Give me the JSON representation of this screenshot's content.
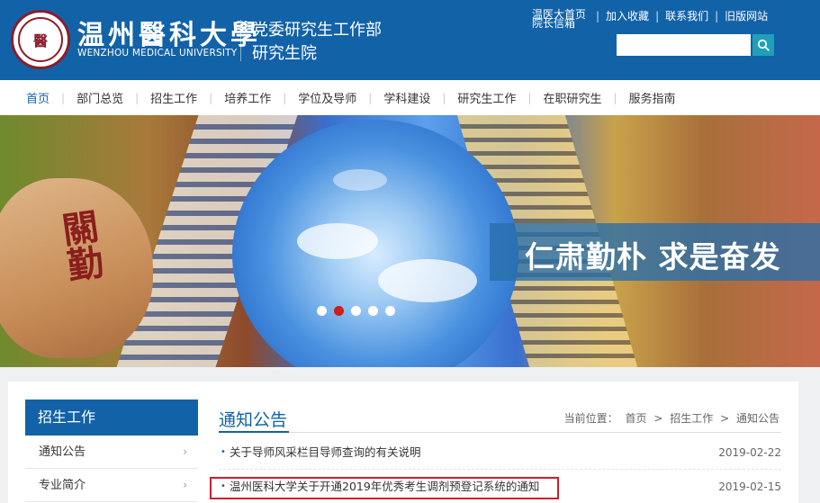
{
  "header": {
    "logo_cn": "温州醫科大學",
    "logo_en": "WENZHOU MEDICAL UNIVERSITY",
    "seal_char": "醫",
    "dept_line1": "党委研究生工作部",
    "dept_line2": "研究生院",
    "toplinks": {
      "stack_a": "温医大首页",
      "stack_b": "院长信箱",
      "favorite": "加入收藏",
      "contact": "联系我们",
      "old_site": "旧版网站",
      "sep": "|"
    },
    "search": {
      "placeholder": ""
    }
  },
  "nav": [
    "首页",
    "部门总览",
    "招生工作",
    "培养工作",
    "学位及导师",
    "学科建设",
    "研究生工作",
    "在职研究生",
    "服务指南"
  ],
  "nav_sep": "|",
  "banner": {
    "rock_text": "關勤",
    "slogan": "仁肃勤朴 求是奋发",
    "slide_count": 5,
    "active_slide": 2
  },
  "sidebar": {
    "title": "招生工作",
    "items": [
      {
        "label": "通知公告"
      },
      {
        "label": "专业简介"
      }
    ],
    "chevron": "›"
  },
  "main": {
    "title": "通知公告",
    "breadcrumb": {
      "prefix": "当前位置：",
      "home": "首页",
      "level1": "招生工作",
      "level2": "通知公告",
      "sep": ">"
    },
    "news": [
      {
        "title": "关于导师风采栏目导师查询的有关说明",
        "date": "2019-02-22"
      },
      {
        "title": "温州医科大学关于开通2019年优秀考生调剂预登记系统的通知",
        "date": "2019-02-15"
      }
    ],
    "bullet": "•"
  },
  "colors": {
    "brand": "#1262a8",
    "accent": "#1fa0b8",
    "highlight": "#d01d2a"
  }
}
